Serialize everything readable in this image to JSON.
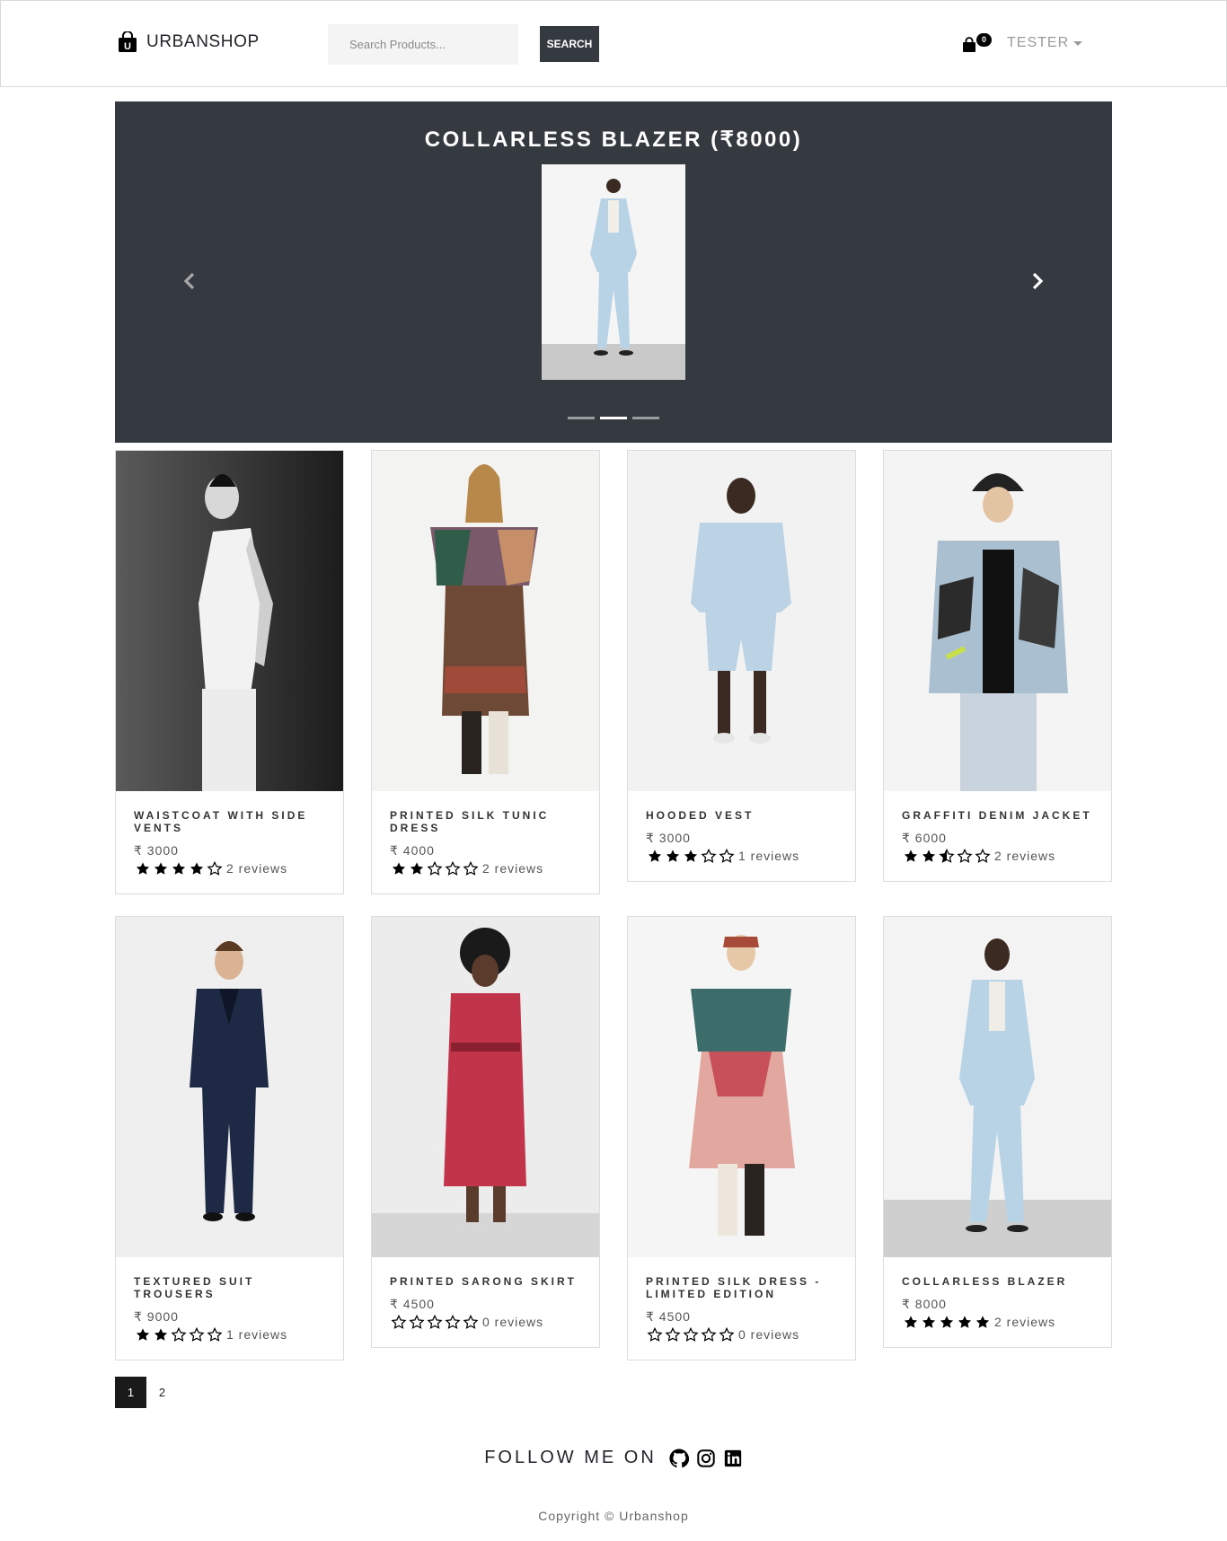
{
  "navbar": {
    "brand": "URBANSHOP",
    "search_placeholder": "Search Products...",
    "search_button": "SEARCH",
    "cart_count": "0",
    "user": "TESTER"
  },
  "carousel": {
    "title": "COLLARLESS BLAZER (₹8000)",
    "slide_count": 3,
    "active_slide": 2
  },
  "products": [
    {
      "name": "WAISTCOAT WITH SIDE VENTS",
      "price": "₹ 3000",
      "rating": 4,
      "reviews": "2 reviews",
      "image": "woman-white-waistcoat-bw"
    },
    {
      "name": "PRINTED SILK TUNIC DRESS",
      "price": "₹ 4000",
      "rating": 2,
      "reviews": "2 reviews",
      "image": "woman-silk-tunic"
    },
    {
      "name": "HOODED VEST",
      "price": "₹ 3000",
      "rating": 3,
      "reviews": "1 reviews",
      "image": "man-blue-hooded-vest"
    },
    {
      "name": "GRAFFITI DENIM JACKET",
      "price": "₹ 6000",
      "rating": 2.5,
      "reviews": "2 reviews",
      "image": "woman-graffiti-denim"
    },
    {
      "name": "TEXTURED SUIT TROUSERS",
      "price": "₹ 9000",
      "rating": 2,
      "reviews": "1 reviews",
      "image": "man-navy-suit"
    },
    {
      "name": "PRINTED SARONG SKIRT",
      "price": "₹ 4500",
      "rating": 0,
      "reviews": "0 reviews",
      "image": "woman-red-floral"
    },
    {
      "name": "PRINTED SILK DRESS - LIMITED EDITION",
      "price": "₹ 4500",
      "rating": 0,
      "reviews": "0 reviews",
      "image": "woman-silk-dress"
    },
    {
      "name": "COLLARLESS BLAZER",
      "price": "₹ 8000",
      "rating": 5,
      "reviews": "2 reviews",
      "image": "woman-blue-blazer"
    }
  ],
  "pagination": {
    "pages": [
      "1",
      "2"
    ],
    "active": "1"
  },
  "footer": {
    "follow_text": "FOLLOW ME ON",
    "social_icons": [
      "github-icon",
      "instagram-icon",
      "linkedin-icon"
    ],
    "copyright": "Copyright © Urbanshop"
  },
  "colors": {
    "dark": "#343a40",
    "page_bg": "#ffffff",
    "badge": "#000000",
    "muted": "#9a9a9a"
  }
}
